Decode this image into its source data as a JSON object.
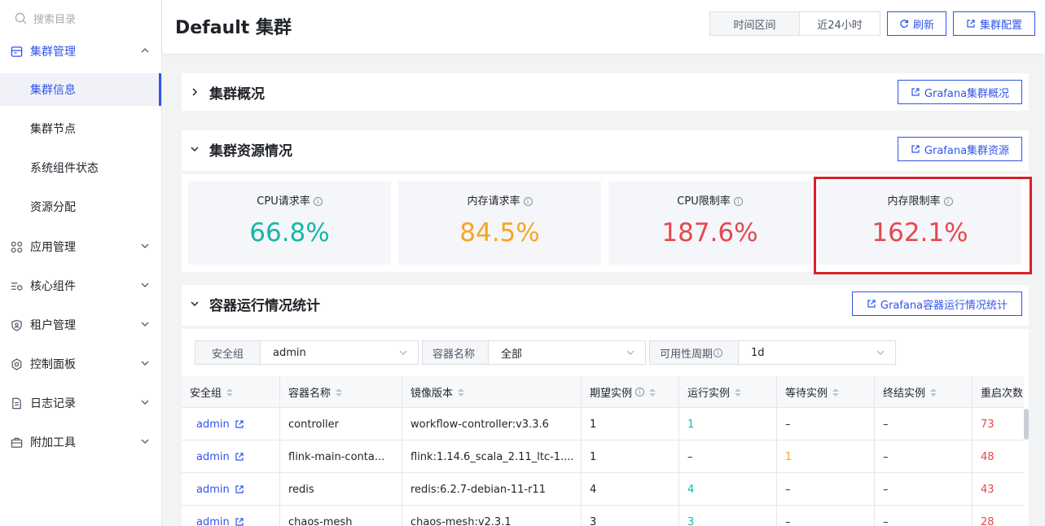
{
  "sidebar": {
    "search_placeholder": "搜索目录",
    "groups": [
      {
        "label": "集群管理",
        "icon": "cluster-icon"
      },
      {
        "label": "应用管理",
        "icon": "apps-icon"
      },
      {
        "label": "核心组件",
        "icon": "components-icon"
      },
      {
        "label": "租户管理",
        "icon": "tenant-icon"
      },
      {
        "label": "控制面板",
        "icon": "gear-icon"
      },
      {
        "label": "日志记录",
        "icon": "log-icon"
      },
      {
        "label": "附加工具",
        "icon": "toolbox-icon"
      }
    ],
    "sub_items": [
      "集群信息",
      "集群节点",
      "系统组件状态",
      "资源分配"
    ]
  },
  "header": {
    "title": "Default 集群",
    "time_range_label": "时间区间",
    "time_range_value": "近24小时",
    "refresh_label": "刷新",
    "config_label": "集群配置"
  },
  "sections": {
    "overview": {
      "title": "集群概况",
      "button": "Grafana集群概况"
    },
    "resources": {
      "title": "集群资源情况",
      "button": "Grafana集群资源"
    },
    "containers": {
      "title": "容器运行情况统计",
      "button": "Grafana容器运行情况统计"
    }
  },
  "metrics": [
    {
      "label": "CPU请求率",
      "value": "66.8%",
      "color": "#14b8a6"
    },
    {
      "label": "内存请求率",
      "value": "84.5%",
      "color": "#f5a623"
    },
    {
      "label": "CPU限制率",
      "value": "187.6%",
      "color": "#e5484d"
    },
    {
      "label": "内存限制率",
      "value": "162.1%",
      "color": "#e5484d"
    }
  ],
  "filters": [
    {
      "label": "安全组",
      "value": "admin"
    },
    {
      "label": "容器名称",
      "value": "全部"
    },
    {
      "label": "可用性周期",
      "value": "1d"
    }
  ],
  "table": {
    "headers": [
      "安全组",
      "容器名称",
      "镜像版本",
      "期望实例",
      "运行实例",
      "等待实例",
      "终结实例",
      "重启次数"
    ],
    "rows": [
      [
        "admin",
        "controller",
        "workflow-controller:v3.3.6",
        "1",
        "1",
        "–",
        "–",
        "73"
      ],
      [
        "admin",
        "flink-main-conta...",
        "flink:1.14.6_scala_2.11_ltc-1....",
        "1",
        "–",
        "1",
        "–",
        "48"
      ],
      [
        "admin",
        "redis",
        "redis:6.2.7-debian-11-r11",
        "4",
        "4",
        "–",
        "–",
        "43"
      ],
      [
        "admin",
        "chaos-mesh",
        "chaos-mesh:v2.3.1",
        "3",
        "3",
        "–",
        "–",
        "28"
      ]
    ]
  },
  "colors": {
    "accent": "#2f54eb",
    "green": "#14b8a6",
    "orange": "#f5a623",
    "red": "#e5484d",
    "highlight": "#d9202a"
  }
}
